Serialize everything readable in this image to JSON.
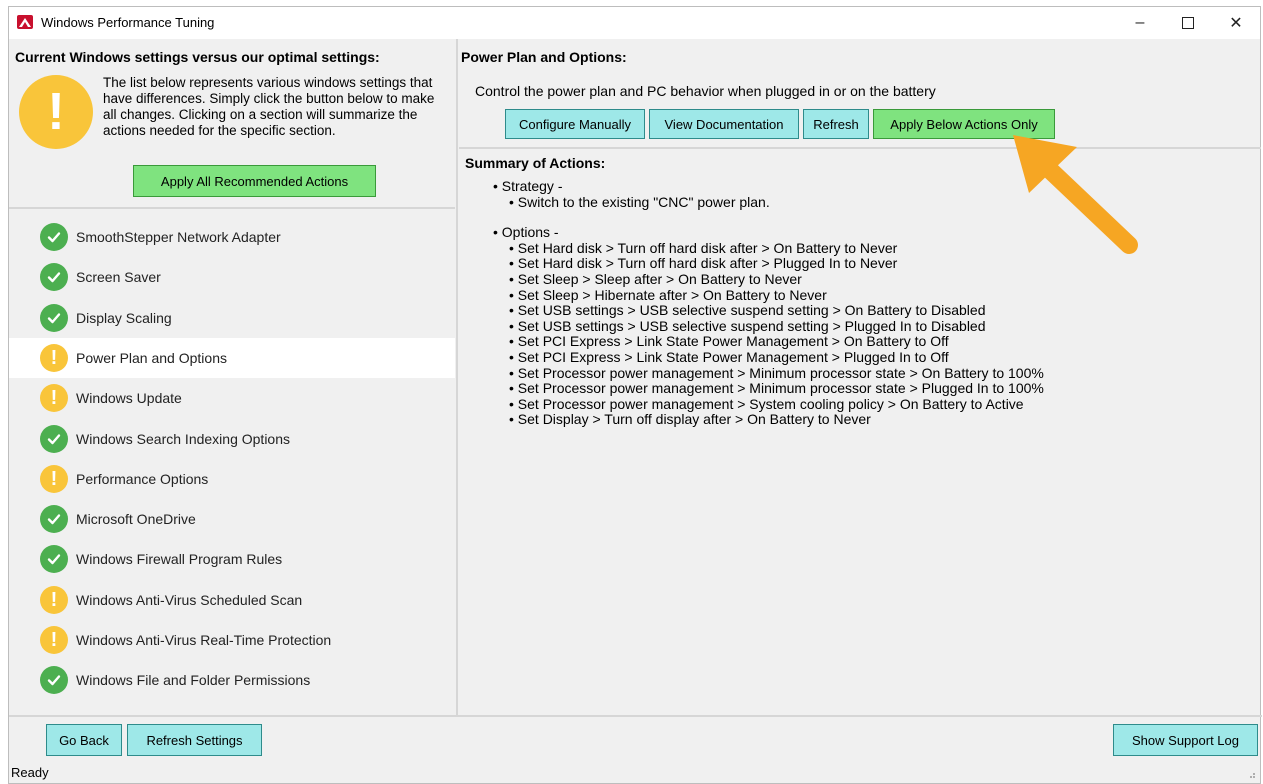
{
  "window": {
    "title": "Windows Performance Tuning"
  },
  "left": {
    "heading": "Current Windows settings versus our optimal settings:",
    "intro": "The list below represents various windows settings that have differences. Simply click the button below to make all changes. Clicking on a section will summarize the actions needed for the specific section.",
    "apply_all_label": "Apply All Recommended Actions",
    "items": [
      {
        "label": "SmoothStepper Network Adapter",
        "status": "ok"
      },
      {
        "label": "Screen Saver",
        "status": "ok"
      },
      {
        "label": "Display Scaling",
        "status": "ok"
      },
      {
        "label": "Power Plan and Options",
        "status": "warn"
      },
      {
        "label": "Windows Update",
        "status": "warn"
      },
      {
        "label": "Windows Search Indexing Options",
        "status": "ok"
      },
      {
        "label": "Performance Options",
        "status": "warn"
      },
      {
        "label": "Microsoft OneDrive",
        "status": "ok"
      },
      {
        "label": "Windows Firewall Program Rules",
        "status": "ok"
      },
      {
        "label": "Windows Anti-Virus Scheduled Scan",
        "status": "warn"
      },
      {
        "label": "Windows Anti-Virus Real-Time Protection",
        "status": "warn"
      },
      {
        "label": "Windows File and Folder Permissions",
        "status": "ok"
      }
    ],
    "selected_item": "Power Plan and Options"
  },
  "right": {
    "heading": "Power Plan and Options:",
    "description": "Control the power plan and PC behavior when plugged in or on the battery",
    "buttons": {
      "configure": "Configure Manually",
      "docs": "View Documentation",
      "refresh": "Refresh",
      "apply_below": "Apply Below Actions Only"
    },
    "summary_heading": "Summary of Actions:",
    "strategy_title": "• Strategy -",
    "strategy_lines": [
      "• Switch to the existing \"CNC\" power plan."
    ],
    "options_title": "• Options -",
    "options_lines": [
      "• Set Hard disk > Turn off hard disk after > On Battery to Never",
      "• Set Hard disk > Turn off hard disk after > Plugged In to Never",
      "• Set Sleep > Sleep after > On Battery to Never",
      "• Set Sleep > Hibernate after > On Battery to Never",
      "• Set USB settings > USB selective suspend setting > On Battery to Disabled",
      "• Set USB settings > USB selective suspend setting > Plugged In to Disabled",
      "• Set PCI Express > Link State Power Management > On Battery to Off",
      "• Set PCI Express > Link State Power Management > Plugged In to Off",
      "• Set Processor power management > Minimum processor state > On Battery to 100%",
      "• Set Processor power management > Minimum processor state > Plugged In to 100%",
      "• Set Processor power management > System cooling policy > On Battery to Active",
      "• Set Display > Turn off display after > On Battery to Never"
    ]
  },
  "bottom": {
    "go_back": "Go Back",
    "refresh_settings": "Refresh Settings",
    "show_support_log": "Show Support Log"
  },
  "statusbar": {
    "text": "Ready"
  },
  "colors": {
    "teal_button": "#9ee8e8",
    "green_button": "#7fe37f",
    "ok": "#4caf50",
    "warn": "#f9c53a",
    "arrow": "#f6a623"
  }
}
